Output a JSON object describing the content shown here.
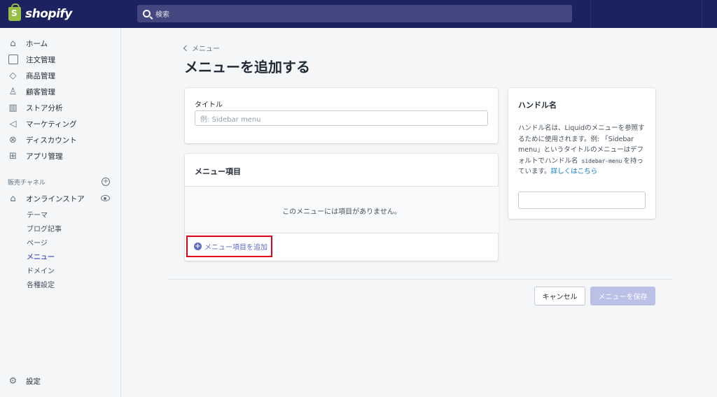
{
  "app": {
    "logo_text": "shopify"
  },
  "search": {
    "placeholder": "検索"
  },
  "sidebar": {
    "items": [
      {
        "label": "ホーム",
        "icon": "home-icon"
      },
      {
        "label": "注文管理",
        "icon": "inbox-icon"
      },
      {
        "label": "商品管理",
        "icon": "tag-icon"
      },
      {
        "label": "顧客管理",
        "icon": "person-icon"
      },
      {
        "label": "ストア分析",
        "icon": "chart-icon"
      },
      {
        "label": "マーケティング",
        "icon": "megaphone-icon"
      },
      {
        "label": "ディスカウント",
        "icon": "discount-icon"
      },
      {
        "label": "アプリ管理",
        "icon": "apps-icon"
      }
    ],
    "channels_header": "販売チャネル",
    "online_store": "オンラインストア",
    "sub_items": [
      "テーマ",
      "ブログ記事",
      "ページ",
      "メニュー",
      "ドメイン",
      "各種設定"
    ],
    "active_sub_item": "メニュー",
    "settings": "設定"
  },
  "main": {
    "breadcrumb": "メニュー",
    "title": "メニューを追加する",
    "title_card": {
      "label": "タイトル",
      "placeholder": "例: Sidebar menu"
    },
    "menu_items_card": {
      "heading": "メニュー項目",
      "empty_text": "このメニューには項目がありません。",
      "add_button": "メニュー項目を追加"
    },
    "handle_card": {
      "heading": "ハンドル名",
      "desc_1": "ハンドル名は、Liquidのメニューを参照するために使用されます。例: 「Sidebar menu」というタイトルのメニューはデフォルトでハンドル名",
      "code": "sidebar-menu",
      "desc_2": "を持っています。",
      "link": "詳しくはこちら",
      "value": ""
    },
    "actions": {
      "cancel": "キャンセル",
      "save": "メニューを保存"
    }
  },
  "colors": {
    "topbar": "#1c2260",
    "accent": "#5c6ac4",
    "highlight": "#e0001a"
  }
}
